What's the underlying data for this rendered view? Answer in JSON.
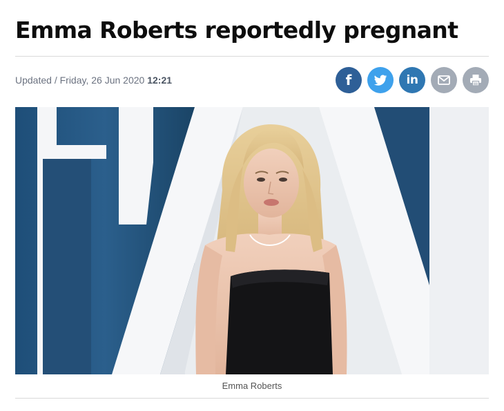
{
  "article": {
    "headline": "Emma Roberts reportedly pregnant",
    "updated_label": "Updated / Friday, 26 Jun 2020",
    "updated_time": "12:21"
  },
  "share": {
    "facebook": {
      "label": "f",
      "color": "#2e5f97",
      "icon": "facebook-icon"
    },
    "twitter": {
      "color": "#3ea1ec",
      "icon": "twitter-icon"
    },
    "linkedin": {
      "label": "in",
      "color": "#2f77b2",
      "icon": "linkedin-icon"
    },
    "email": {
      "color": "#a3abb6",
      "icon": "email-icon"
    },
    "print": {
      "color": "#a3abb6",
      "icon": "print-icon"
    }
  },
  "hero": {
    "caption": "Emma Roberts"
  }
}
